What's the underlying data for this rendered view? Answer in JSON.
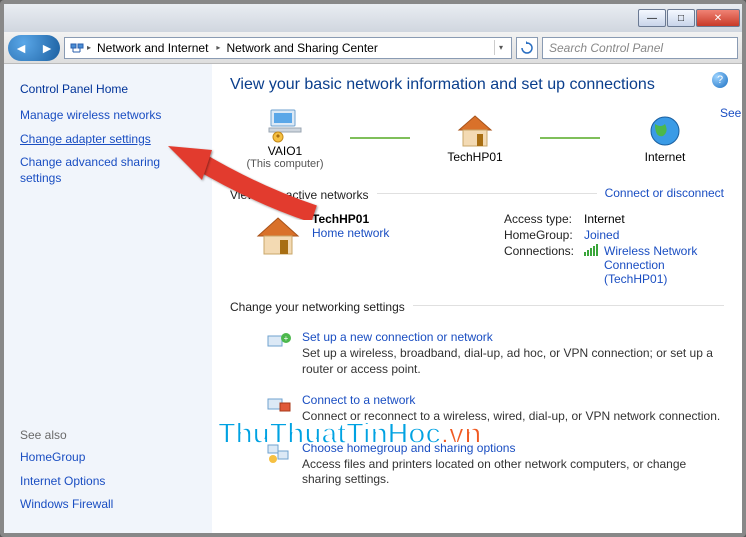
{
  "titlebar": {
    "min": "—",
    "max": "□",
    "close": "✕"
  },
  "nav": {
    "crumb_group_icon": "network-icon",
    "crumb1": "Network and Internet",
    "crumb2": "Network and Sharing Center",
    "search_placeholder": "Search Control Panel"
  },
  "sidebar": {
    "home": "Control Panel Home",
    "links": [
      "Manage wireless networks",
      "Change adapter settings",
      "Change advanced sharing settings"
    ],
    "see_also_heading": "See also",
    "see_also": [
      "HomeGroup",
      "Internet Options",
      "Windows Firewall"
    ]
  },
  "main": {
    "title": "View your basic network information and set up connections",
    "see_full_map": "See full map",
    "nodes": {
      "computer_name": "VAIO1",
      "computer_sub": "(This computer)",
      "gateway_name": "TechHP01",
      "internet_name": "Internet"
    },
    "active_heading": "View your active networks",
    "connect_disconnect": "Connect or disconnect",
    "active": {
      "name": "TechHP01",
      "type": "Home network",
      "access_label": "Access type:",
      "access_value": "Internet",
      "homegroup_label": "HomeGroup:",
      "homegroup_value": "Joined",
      "connections_label": "Connections:",
      "connections_value": "Wireless Network Connection (TechHP01)"
    },
    "change_heading": "Change your networking settings",
    "tasks": [
      {
        "link": "Set up a new connection or network",
        "desc": "Set up a wireless, broadband, dial-up, ad hoc, or VPN connection; or set up a router or access point."
      },
      {
        "link": "Connect to a network",
        "desc": "Connect or reconnect to a wireless, wired, dial-up, or VPN network connection."
      },
      {
        "link": "Choose homegroup and sharing options",
        "desc": "Access files and printers located on other network computers, or change sharing settings."
      }
    ]
  },
  "watermark": {
    "main": "ThuThuatTinHoc",
    "suffix": ".vn"
  }
}
